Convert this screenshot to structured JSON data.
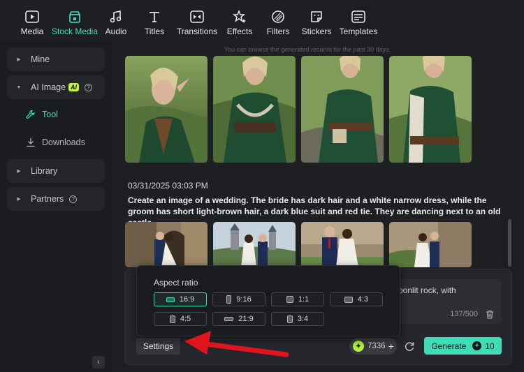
{
  "toolbar": {
    "items": [
      {
        "label": "Media",
        "icon": "media-icon"
      },
      {
        "label": "Stock Media",
        "icon": "stock-media-icon"
      },
      {
        "label": "Audio",
        "icon": "audio-icon"
      },
      {
        "label": "Titles",
        "icon": "titles-icon"
      },
      {
        "label": "Transitions",
        "icon": "transitions-icon"
      },
      {
        "label": "Effects",
        "icon": "effects-icon"
      },
      {
        "label": "Filters",
        "icon": "filters-icon"
      },
      {
        "label": "Stickers",
        "icon": "stickers-icon"
      },
      {
        "label": "Templates",
        "icon": "templates-icon"
      }
    ],
    "active": "Stock Media",
    "accent_color": "#3ee0bf"
  },
  "sidebar": {
    "mine": "Mine",
    "ai_image": "AI Image",
    "ai_badge": "AI",
    "tool": "Tool",
    "downloads": "Downloads",
    "library": "Library",
    "partners": "Partners",
    "help_glyph": "?",
    "collapse_glyph": "‹"
  },
  "main": {
    "notice": "You can browse the generated records for the past 30 days.",
    "record2": {
      "date": "03/31/2025 03:03 PM",
      "prompt": "Create an image of a wedding. The bride has dark hair and a white narrow dress, while the groom has short light-brown hair, a dark blue suit and red tie. They are dancing next to an old castle."
    }
  },
  "composer": {
    "prompt_line1": "oonlit rock, with",
    "char_count": "137/500",
    "settings_label": "Settings",
    "credits_value": "7336",
    "credits_plus": "+",
    "generate_label": "Generate",
    "generate_cost": "10",
    "coin_glyph": "✦"
  },
  "aspect_popover": {
    "title": "Aspect ratio",
    "options": [
      "16:9",
      "9:16",
      "1:1",
      "4:3",
      "4:5",
      "21:9",
      "3:4"
    ],
    "selected": "16:9"
  },
  "colors": {
    "accent": "#3ee0bf",
    "generate_bg": "#3fdcb8",
    "credit_coin": "#b8f23b",
    "annotation_arrow": "#e0141c"
  }
}
